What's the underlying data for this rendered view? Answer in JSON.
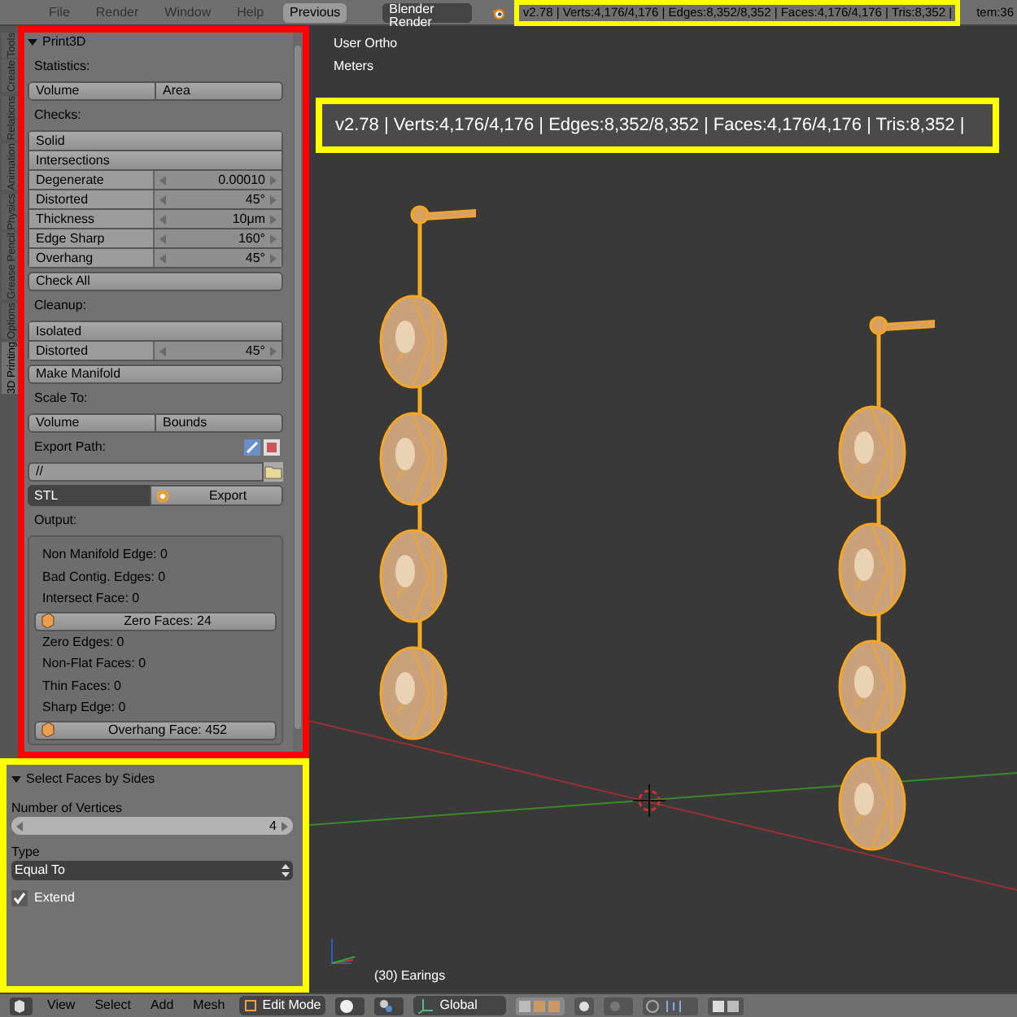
{
  "menu": [
    {
      "label": "File"
    },
    {
      "label": "Render"
    },
    {
      "label": "Window"
    },
    {
      "label": "Help"
    }
  ],
  "header": {
    "back_button": "Previous",
    "render_engine": "Blender Render",
    "stats": "v2.78 | Verts:4,176/4,176 | Edges:8,352/8,352 | Faces:4,176/4,176 | Tris:8,352 |",
    "stats_overflow": "tem:36"
  },
  "tool_tabs": [
    {
      "label": "Tools",
      "selected": false
    },
    {
      "label": "Create",
      "selected": false
    },
    {
      "label": "Relations",
      "selected": false
    },
    {
      "label": "Animation",
      "selected": false
    },
    {
      "label": "Physics",
      "selected": false
    },
    {
      "label": "Grease Pencil",
      "selected": false
    },
    {
      "label": "Options",
      "selected": false
    },
    {
      "label": "3D Printing",
      "selected": true
    }
  ],
  "print3d": {
    "title": "Print3D",
    "expanded": true,
    "rows": [
      {
        "kind": "label",
        "text": "Statistics:"
      },
      {
        "kind": "pair",
        "items": [
          "Volume",
          "Area"
        ]
      },
      {
        "kind": "label",
        "text": "Checks:"
      },
      {
        "kind": "group",
        "rows": [
          {
            "kind": "button",
            "text": "Solid"
          },
          {
            "kind": "button",
            "text": "Intersections"
          },
          {
            "kind": "number",
            "label": "Degenerate",
            "value": "0.00010"
          },
          {
            "kind": "number",
            "label": "Distorted",
            "value": "45°"
          },
          {
            "kind": "number",
            "label": "Thickness",
            "value": "10μm"
          },
          {
            "kind": "number",
            "label": "Edge Sharp",
            "value": "160°"
          },
          {
            "kind": "number",
            "label": "Overhang",
            "value": "45°"
          }
        ]
      },
      {
        "kind": "button",
        "text": "Check All"
      },
      {
        "kind": "label",
        "text": "Cleanup:"
      },
      {
        "kind": "group",
        "rows": [
          {
            "kind": "button",
            "text": "Isolated"
          },
          {
            "kind": "number",
            "label": "Distorted",
            "value": "45°"
          }
        ]
      },
      {
        "kind": "button",
        "text": "Make Manifold"
      },
      {
        "kind": "label",
        "text": "Scale To:"
      },
      {
        "kind": "pair",
        "items": [
          "Volume",
          "Bounds"
        ]
      },
      {
        "kind": "path_label",
        "text": "Export Path:"
      },
      {
        "kind": "path",
        "value": "//"
      },
      {
        "kind": "export",
        "format": "STL",
        "button": "Export"
      },
      {
        "kind": "label",
        "text": "Output:"
      },
      {
        "kind": "output",
        "items": [
          {
            "kind": "text",
            "text": "Non Manifold Edge: 0"
          },
          {
            "kind": "text",
            "text": "Bad Contig. Edges: 0"
          },
          {
            "kind": "text",
            "text": "Intersect Face: 0"
          },
          {
            "kind": "button",
            "text": "Zero Faces: 24"
          },
          {
            "kind": "text",
            "text": "Zero Edges: 0"
          },
          {
            "kind": "text",
            "text": "Non-Flat Faces: 0"
          },
          {
            "kind": "text",
            "text": "Thin Faces: 0"
          },
          {
            "kind": "text",
            "text": "Sharp Edge: 0"
          },
          {
            "kind": "button",
            "text": "Overhang Face: 452"
          }
        ]
      }
    ]
  },
  "operator_panel": {
    "title": "Select Faces by Sides",
    "expanded": true,
    "vertices_label": "Number of Vertices",
    "vertices_value": "4",
    "type_label": "Type",
    "type_value": "Equal To",
    "extend": {
      "label": "Extend",
      "checked": true
    }
  },
  "viewport": {
    "view_name": "User Ortho",
    "units": "Meters",
    "object_info": "(30) Earings",
    "callout": "v2.78 | Verts:4,176/4,176 | Edges:8,352/8,352 | Faces:4,176/4,176 | Tris:8,352 |"
  },
  "bottom_bar": {
    "menus": [
      {
        "label": "View"
      },
      {
        "label": "Select"
      },
      {
        "label": "Add"
      },
      {
        "label": "Mesh"
      }
    ],
    "mode": "Edit Mode",
    "orientation": "Global"
  }
}
